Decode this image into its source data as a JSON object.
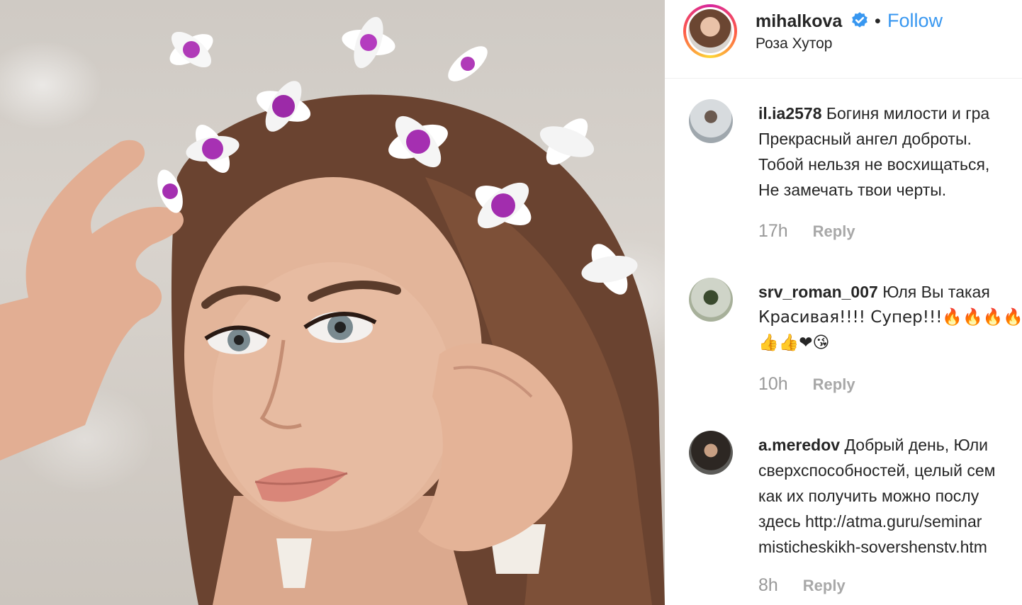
{
  "post": {
    "username": "mihalkova",
    "separator": "•",
    "follow_label": "Follow",
    "location": "Роза Хутор",
    "verified_icon": "verified-badge-icon",
    "accent_color": "#3897f0"
  },
  "comments": [
    {
      "username": "il.ia2578",
      "lines": [
        "Богиня милости и гра",
        "Прекрасный ангел доброты.",
        "Тобой нельзя не восхищаться,",
        "Не замечать твои черты."
      ],
      "time": "17h",
      "reply_label": "Reply"
    },
    {
      "username": "srv_roman_007",
      "lines": [
        "Юля Вы такая",
        "Красивая!!!! Супер!!!🔥🔥🔥🔥",
        "👍👍❤😘"
      ],
      "time": "10h",
      "reply_label": "Reply"
    },
    {
      "username": "a.meredov",
      "lines": [
        "Добрый день, Юли",
        "сверхспособностей, целый сем",
        "как их получить можно послу",
        "здесь http://atma.guru/seminar",
        "misticheskikh-sovershenstv.htm"
      ],
      "time": "8h",
      "reply_label": "Reply"
    }
  ]
}
